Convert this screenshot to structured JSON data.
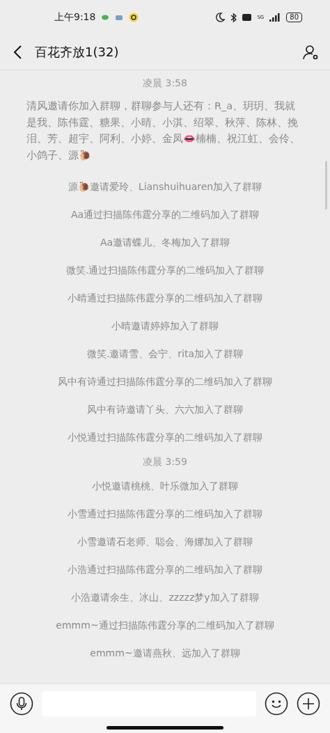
{
  "status_bar": {
    "time": "上午9:18",
    "battery": "80",
    "network": "5G"
  },
  "header": {
    "title": "百花齐放1(32)"
  },
  "messages": [
    {
      "kind": "time",
      "text": "凌晨 3:58"
    },
    {
      "kind": "notice",
      "text": "清风邀请你加入群聊，群聊参与人还有：R_a、玥玥、我就是我、陈伟霆、糖果、小晴、小淇、绍翠、秋萍、陈林、挽泪、芳、超宇、阿利、小婷、金凤👄楠楠、祝江虹、会伶、小鸽子、源🐌"
    },
    {
      "kind": "system",
      "text": "源🐌邀请爱玲、Lianshuihuaren加入了群聊"
    },
    {
      "kind": "system",
      "text": "Aa通过扫描陈伟霆分享的二维码加入了群聊"
    },
    {
      "kind": "system",
      "text": "Aa邀请蝶儿、冬梅加入了群聊"
    },
    {
      "kind": "system",
      "text": "微笑.通过扫描陈伟霆分享的二维码加入了群聊"
    },
    {
      "kind": "system",
      "text": "小晴通过扫描陈伟霆分享的二维码加入了群聊"
    },
    {
      "kind": "system",
      "text": "小晴邀请婷婷加入了群聊"
    },
    {
      "kind": "system",
      "text": "微笑.邀请雪、会宁、rita加入了群聊"
    },
    {
      "kind": "system",
      "text": "风中有诗通过扫描陈伟霆分享的二维码加入了群聊"
    },
    {
      "kind": "system",
      "text": "风中有诗邀请丫头、六六加入了群聊"
    },
    {
      "kind": "system",
      "text": "小悦通过扫描陈伟霆分享的二维码加入了群聊"
    },
    {
      "kind": "time",
      "text": "凌晨 3:59"
    },
    {
      "kind": "system",
      "text": "小悦邀请桃桃、叶乐微加入了群聊"
    },
    {
      "kind": "system",
      "text": "小雪通过扫描陈伟霆分享的二维码加入了群聊"
    },
    {
      "kind": "system",
      "text": "小雪邀请石老师、聪会、海娜加入了群聊"
    },
    {
      "kind": "system",
      "text": "小浩通过扫描陈伟霆分享的二维码加入了群聊"
    },
    {
      "kind": "system",
      "text": "小浩邀请余生、冰山、zzzzz梦y加入了群聊"
    },
    {
      "kind": "system",
      "text": "emmm~通过扫描陈伟霆分享的二维码加入了群聊"
    },
    {
      "kind": "system",
      "text": "emmm~邀请燕秋、远加入了群聊"
    }
  ]
}
